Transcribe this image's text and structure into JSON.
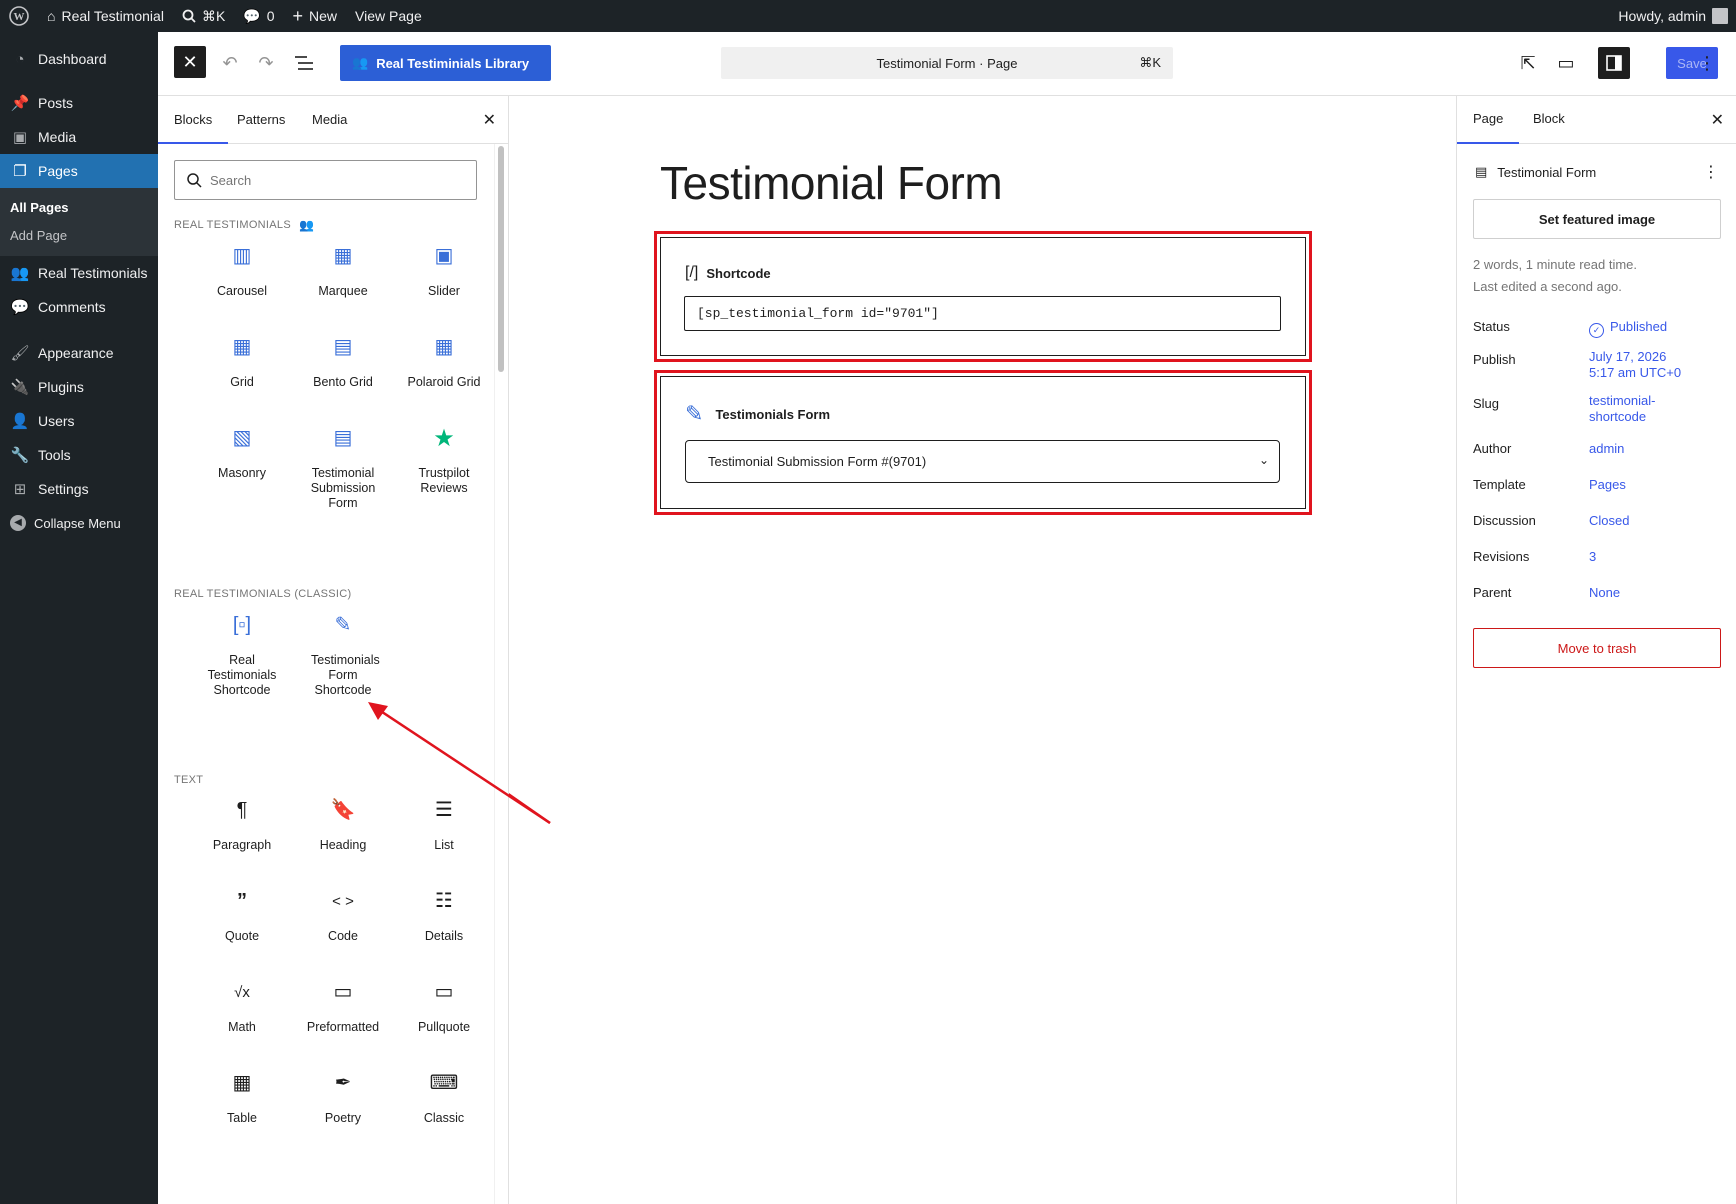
{
  "adminbar": {
    "site_name": "Real Testimonial",
    "search_shortcut": "⌘K",
    "comments_count": "0",
    "new_label": "New",
    "view_page": "View Page",
    "howdy": "Howdy, admin"
  },
  "adminmenu": {
    "dashboard": "Dashboard",
    "posts": "Posts",
    "media": "Media",
    "pages": "Pages",
    "all_pages": "All Pages",
    "add_page": "Add Page",
    "real_testimonials": "Real Testimonials",
    "comments": "Comments",
    "appearance": "Appearance",
    "plugins": "Plugins",
    "users": "Users",
    "tools": "Tools",
    "settings": "Settings",
    "collapse": "Collapse Menu"
  },
  "header": {
    "library_button": "Real Testiminials Library",
    "doc_title": "Testimonial Form · Page",
    "doc_shortcut": "⌘K",
    "save": "Save"
  },
  "inserter": {
    "tabs": [
      "Blocks",
      "Patterns",
      "Media"
    ],
    "search_placeholder": "Search",
    "cat_rt": "REAL TESTIMONIALS",
    "cat_rt_classic": "REAL TESTIMONIALS (CLASSIC)",
    "cat_text": "TEXT",
    "rt_blocks": {
      "carousel": "Carousel",
      "marquee": "Marquee",
      "slider": "Slider",
      "grid": "Grid",
      "bento": "Bento Grid",
      "polaroid": "Polaroid Grid",
      "masonry": "Masonry",
      "submission": "Testimonial Submission Form",
      "trustpilot": "Trustpilot Reviews"
    },
    "classic_blocks": {
      "shortcode": "Real Testimonials Shortcode",
      "form_shortcode": "Testimonials Form Shortcode"
    },
    "text_blocks": {
      "paragraph": "Paragraph",
      "heading": "Heading",
      "list": "List",
      "quote": "Quote",
      "code": "Code",
      "details": "Details",
      "math": "Math",
      "preformatted": "Preformatted",
      "pullquote": "Pullquote",
      "table": "Table",
      "poetry": "Poetry",
      "classic": "Classic"
    }
  },
  "canvas": {
    "title": "Testimonial Form",
    "shortcode_label": "Shortcode",
    "shortcode_value": "[sp_testimonial_form id=\"9701\"]",
    "form_label": "Testimonials Form",
    "form_select": "Testimonial Submission Form #(9701)"
  },
  "sidebar": {
    "tabs": [
      "Page",
      "Block"
    ],
    "doc_title": "Testimonial Form",
    "featured": "Set featured image",
    "meta_words": "2 words, 1 minute read time.",
    "meta_edited": "Last edited a second ago.",
    "status_k": "Status",
    "status_v": "Published",
    "publish_k": "Publish",
    "publish_v1": "July 17, 2026",
    "publish_v2": "5:17 am UTC+0",
    "slug_k": "Slug",
    "slug_v1": "testimonial-",
    "slug_v2": "shortcode",
    "author_k": "Author",
    "author_v": "admin",
    "template_k": "Template",
    "template_v": "Pages",
    "discussion_k": "Discussion",
    "discussion_v": "Closed",
    "revisions_k": "Revisions",
    "revisions_v": "3",
    "parent_k": "Parent",
    "parent_v": "None",
    "trash": "Move to trash"
  },
  "colors": {
    "accent": "#3858e9",
    "library_button": "#2c5fd6",
    "highlight_red": "#e0141e",
    "admin_dark": "#1d2327",
    "admin_current": "#2271b1",
    "trustpilot_star": "#00b67a"
  }
}
